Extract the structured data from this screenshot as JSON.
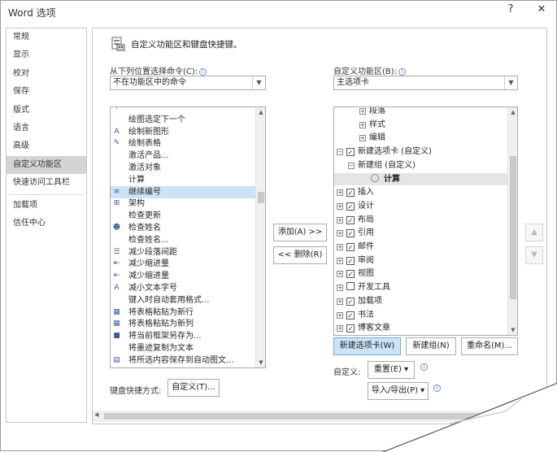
{
  "window": {
    "title": "Word 选项",
    "help": "?",
    "close": "✕"
  },
  "nav": [
    "常规",
    "显示",
    "校对",
    "保存",
    "版式",
    "语言",
    "高级",
    "自定义功能区",
    "快速访问工具栏",
    "加载项",
    "信任中心"
  ],
  "header": {
    "title": "自定义功能区和键盘快捷键。"
  },
  "left": {
    "label": "从下列位置选择命令(C):",
    "dropdown": "不在功能区中的命令",
    "items": [
      {
        "text": "",
        "icon": "move-icon"
      },
      {
        "text": "绘图选定下一个",
        "icon": ""
      },
      {
        "text": "绘制新图形",
        "icon": "shape-icon"
      },
      {
        "text": "绘制表格",
        "icon": "pencil-icon"
      },
      {
        "text": "激活产品...",
        "icon": ""
      },
      {
        "text": "激活对象",
        "icon": ""
      },
      {
        "text": "计算",
        "icon": ""
      },
      {
        "text": "继续编号",
        "icon": "list-icon"
      },
      {
        "text": "架构",
        "icon": "schema-icon"
      },
      {
        "text": "检查更新",
        "icon": ""
      },
      {
        "text": "检查姓名",
        "icon": "person-icon"
      },
      {
        "text": "检查姓名...",
        "icon": ""
      },
      {
        "text": "减少段落间距",
        "icon": "spacing-icon"
      },
      {
        "text": "减少缩进量",
        "icon": "indent-icon"
      },
      {
        "text": "减少缩进量",
        "icon": "indent-icon"
      },
      {
        "text": "减小文本字号",
        "icon": "font-size-icon"
      },
      {
        "text": "键入时自动套用格式...",
        "icon": ""
      },
      {
        "text": "将表格粘贴为新行",
        "icon": "table-icon"
      },
      {
        "text": "将表格粘贴为新列",
        "icon": "table-icon"
      },
      {
        "text": "将当前框架另存为...",
        "icon": "save-icon"
      },
      {
        "text": "将墨迹复制为文本",
        "icon": ""
      },
      {
        "text": "将所选内容保存到自动图文...",
        "icon": "doc-icon"
      }
    ]
  },
  "middle": {
    "add": "添加(A) >>",
    "remove": "<< 删除(R)"
  },
  "right": {
    "label": "自定义功能区(B):",
    "dropdown": "主选项卡",
    "items": [
      {
        "text": "段落",
        "level": 2,
        "exp": "+",
        "cb": null
      },
      {
        "text": "样式",
        "level": 2,
        "exp": "+",
        "cb": null
      },
      {
        "text": "编辑",
        "level": 2,
        "exp": "+",
        "cb": null
      },
      {
        "text": "新建选项卡 (自定义)",
        "level": 0,
        "exp": "−",
        "cb": "✓"
      },
      {
        "text": "新建组 (自定义)",
        "level": 1,
        "exp": "−",
        "cb": null
      },
      {
        "text": "计算",
        "level": 3,
        "exp": "",
        "cb": null
      },
      {
        "text": "插入",
        "level": 0,
        "exp": "+",
        "cb": "✓"
      },
      {
        "text": "设计",
        "level": 0,
        "exp": "+",
        "cb": "✓"
      },
      {
        "text": "布局",
        "level": 0,
        "exp": "+",
        "cb": "✓"
      },
      {
        "text": "引用",
        "level": 0,
        "exp": "+",
        "cb": "✓"
      },
      {
        "text": "邮件",
        "level": 0,
        "exp": "+",
        "cb": "✓"
      },
      {
        "text": "审阅",
        "level": 0,
        "exp": "+",
        "cb": "✓"
      },
      {
        "text": "视图",
        "level": 0,
        "exp": "+",
        "cb": "✓"
      },
      {
        "text": "开发工具",
        "level": 0,
        "exp": "+",
        "cb": ""
      },
      {
        "text": "加载项",
        "level": 0,
        "exp": "+",
        "cb": "✓"
      },
      {
        "text": "书法",
        "level": 0,
        "exp": "+",
        "cb": "✓"
      },
      {
        "text": "博客文章",
        "level": 0,
        "exp": "+",
        "cb": "✓"
      }
    ],
    "new_tab": "新建选项卡(W)",
    "new_group": "新建组(N)",
    "rename": "重命名(M)...",
    "customize_label": "自定义:",
    "reset": "重置(E) ▾",
    "import_export": "导入/导出(P) ▾"
  },
  "keyboard": {
    "label": "键盘快捷方式:",
    "button": "自定义(T)..."
  }
}
